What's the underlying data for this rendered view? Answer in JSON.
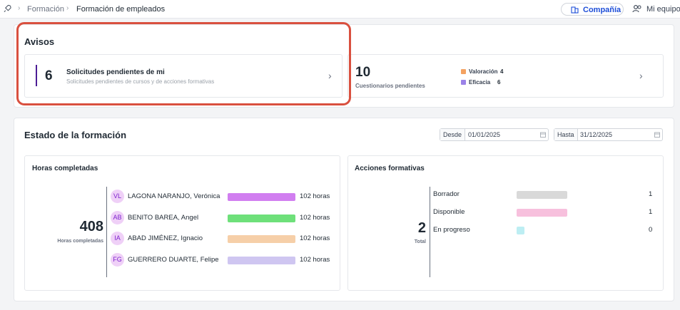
{
  "breadcrumb": {
    "section": "Formación",
    "current": "Formación de empleados"
  },
  "view_switch": {
    "company": "Compañía",
    "team": "Mi equipo"
  },
  "avisos": {
    "title": "Avisos",
    "requests": {
      "count": "6",
      "title": "Solicitudes pendientes de mi",
      "subtitle": "Solicitudes pendientes de cursos y de acciones formativas"
    },
    "surveys": {
      "count": "10",
      "label": "Cuestionarios pendientes",
      "legend": [
        {
          "label": "Valoración",
          "value": "4",
          "color": "#f4a261"
        },
        {
          "label": "Eficacia",
          "value": "6",
          "color": "#9b82e8"
        }
      ]
    }
  },
  "estado": {
    "title": "Estado de la formación",
    "from": {
      "label": "Desde",
      "value": "01/01/2025"
    },
    "to": {
      "label": "Hasta",
      "value": "31/12/2025"
    }
  },
  "horas": {
    "title": "Horas completadas",
    "total": "408",
    "total_label": "Horas completadas",
    "people": [
      {
        "initials": "VL",
        "name": "LAGONA NARANJO, Verónica",
        "hours": "102 horas",
        "color": "#d17ef0",
        "fill": 1.0
      },
      {
        "initials": "AB",
        "name": "BENITO BAREA, Angel",
        "hours": "102 horas",
        "color": "#6ee07a",
        "fill": 1.0
      },
      {
        "initials": "IA",
        "name": "ABAD JIMÉNEZ, Ignacio",
        "hours": "102 horas",
        "color": "#f6cfa8",
        "fill": 1.0
      },
      {
        "initials": "FG",
        "name": "GUERRERO DUARTE, Felipe",
        "hours": "102 horas",
        "color": "#cfc6f1",
        "fill": 1.0
      }
    ]
  },
  "acciones": {
    "title": "Acciones formativas",
    "total": "2",
    "total_label": "Total",
    "items": [
      {
        "name": "Borrador",
        "value": "1",
        "color": "#d9d9d9",
        "fill": 1.0
      },
      {
        "name": "Disponible",
        "value": "1",
        "color": "#f7c0dd",
        "fill": 1.0
      },
      {
        "name": "En progreso",
        "value": "0",
        "color": "#bdeef3",
        "fill": 0.0
      }
    ]
  },
  "colors": {
    "accent": "#4c1d95",
    "highlight": "#d9503f",
    "link": "#1d4ed8"
  }
}
